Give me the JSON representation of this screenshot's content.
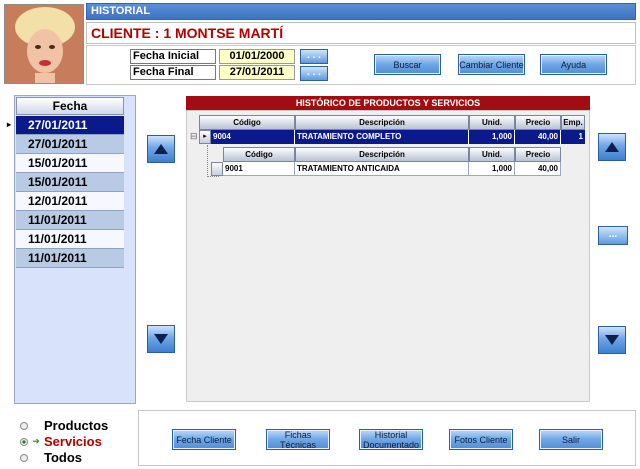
{
  "window": {
    "title": "HISTORIAL"
  },
  "client": {
    "label": "CLIENTE : 1 MONTSE MARTÍ"
  },
  "dates": {
    "start_label": "Fecha Inicial",
    "start_value": "01/01/2000",
    "end_label": "Fecha Final",
    "end_value": "27/01/2011",
    "picker_label": ". . ."
  },
  "top_buttons": {
    "search": "Buscar",
    "change_client": "Cambiar Cliente",
    "help": "Ayuda"
  },
  "date_list": {
    "header": "Fecha",
    "items": [
      "27/01/2011",
      "27/01/2011",
      "15/01/2011",
      "15/01/2011",
      "12/01/2011",
      "11/01/2011",
      "11/01/2011",
      "11/01/2011"
    ],
    "selected_index": 0,
    "selected_marker": "▸"
  },
  "history": {
    "title": "HISTÓRICO DE PRODUCTOS Y SERVICIOS",
    "columns": [
      "Código",
      "Descripción",
      "Unid.",
      "Precio",
      "Emp."
    ],
    "row": {
      "code": "9004",
      "description": "TRATAMIENTO COMPLETO",
      "units": "1,000",
      "price": "40,00",
      "emp": "1"
    },
    "expand_glyph": "⊟",
    "sub_columns": [
      "Código",
      "Descripción",
      "Unid.",
      "Precio"
    ],
    "sub_row": {
      "code": "9001",
      "description": "TRATAMIENTO ANTICAIDA",
      "units": "1,000",
      "price": "40,00"
    }
  },
  "more_button": "...",
  "filters": {
    "options": [
      "Productos",
      "Servicios",
      "Todos"
    ],
    "selected_index": 1,
    "selected_color": "#b00000"
  },
  "bottom_buttons": {
    "client_card": "Fecha Cliente",
    "technical_sheets": "Fichas Técnicas",
    "documented_history": "Historial Documentado",
    "client_photos": "Fotos Cliente",
    "exit": "Salir"
  },
  "icons": {
    "up": "arrow-up-icon",
    "down": "arrow-down-icon"
  },
  "colors": {
    "title_bar": "#4a7fcc",
    "accent_red": "#a10d12",
    "selected_row": "#0b1a8a",
    "date_yellow": "#ffffc8"
  }
}
